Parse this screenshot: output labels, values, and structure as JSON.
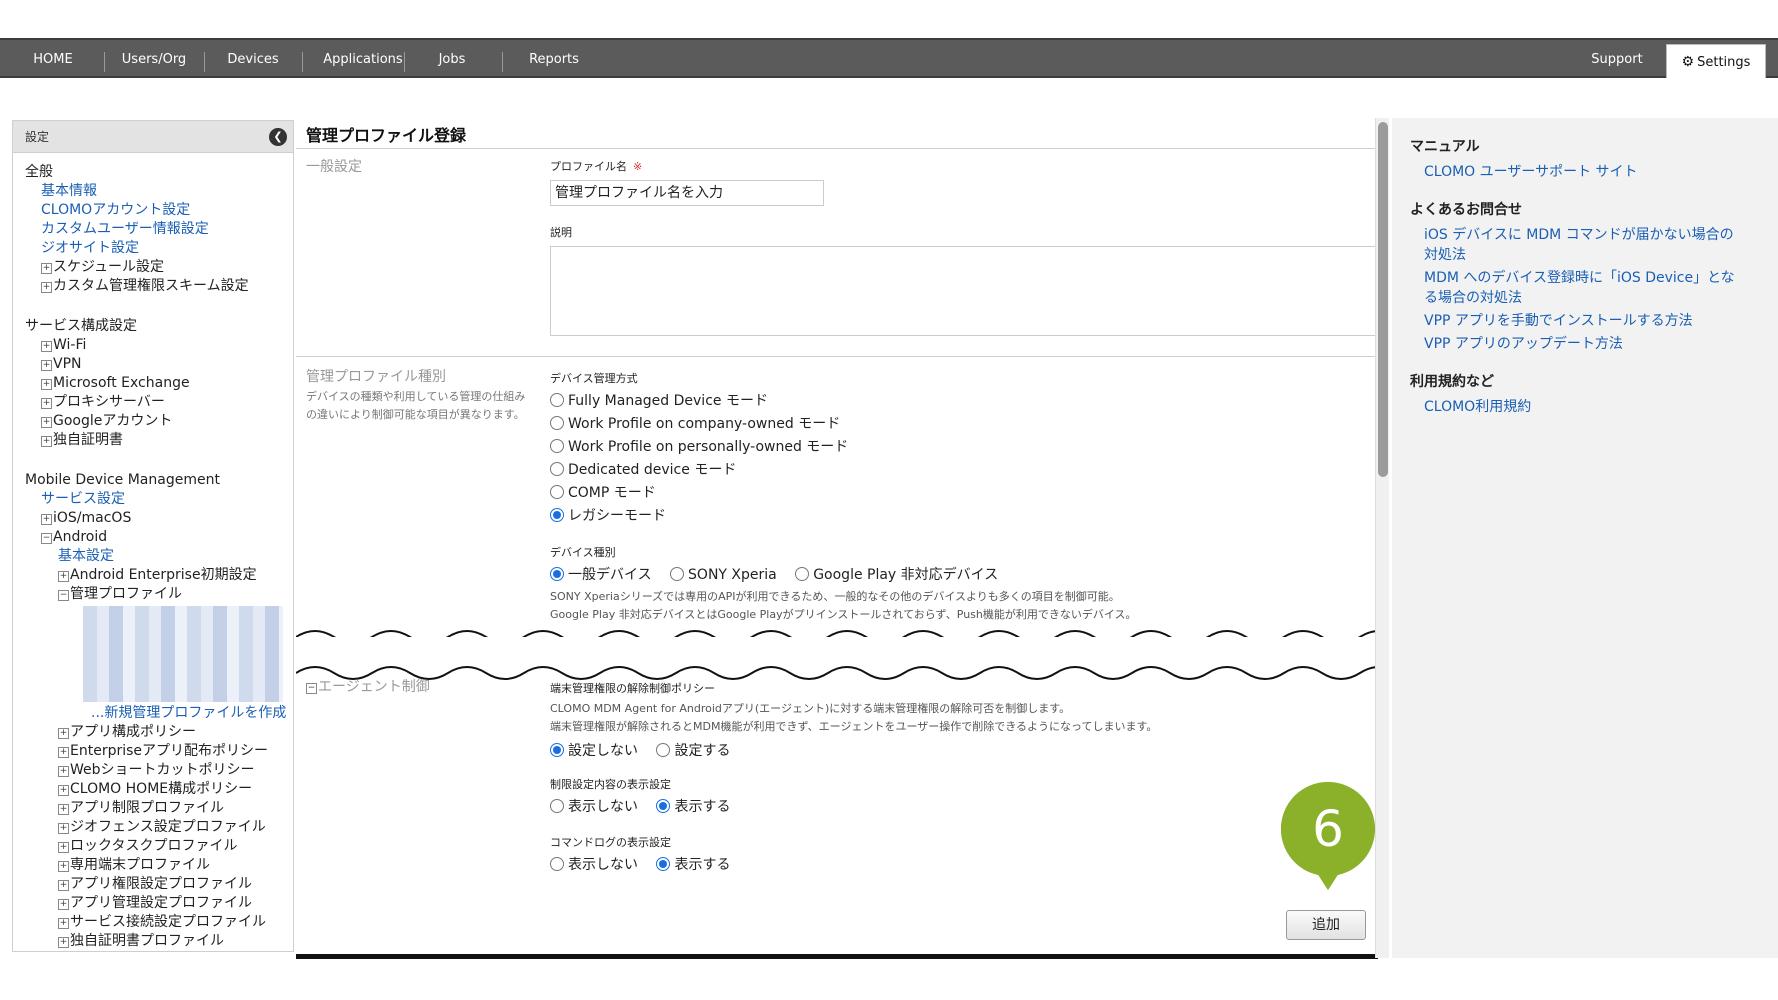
{
  "nav": {
    "items": [
      "HOME",
      "Users/Org",
      "Devices",
      "Applications",
      "Jobs",
      "Reports"
    ],
    "support": "Support",
    "settings": "Settings"
  },
  "sidebar": {
    "header": "設定",
    "general_title": "全般",
    "general_links": [
      "基本情報",
      "CLOMOアカウント設定",
      "カスタムユーザー情報設定",
      "ジオサイト設定"
    ],
    "general_expand": [
      "スケジュール設定",
      "カスタム管理権限スキーム設定"
    ],
    "service_title": "サービス構成設定",
    "service_items": [
      "Wi-Fi",
      "VPN",
      "Microsoft Exchange",
      "プロキシサーバー",
      "Googleアカウント",
      "独自証明書"
    ],
    "mdm_title": "Mobile Device Management",
    "mdm_service": "サービス設定",
    "ios": "iOS/macOS",
    "android": "Android",
    "android_basic": "基本設定",
    "android_enterprise": "Android Enterprise初期設定",
    "mgmt_profile": "管理プロファイル",
    "new_profile": "...新規管理プロファイルを作成",
    "policies": [
      "アプリ構成ポリシー",
      "Enterpriseアプリ配布ポリシー",
      "Webショートカットポリシー",
      "CLOMO HOME構成ポリシー",
      "アプリ制限プロファイル",
      "ジオフェンス設定プロファイル",
      "ロックタスクプロファイル",
      "専用端末プロファイル",
      "アプリ権限設定プロファイル",
      "アプリ管理設定プロファイル",
      "サービス接続設定プロファイル",
      "独自証明書プロファイル"
    ]
  },
  "main": {
    "title": "管理プロファイル登録",
    "general_section": "一般設定",
    "profile_name_label": "プロファイル名",
    "required_mark": "※",
    "profile_name_value": "管理プロファイル名を入力",
    "description_label": "説明",
    "type_section": "管理プロファイル種別",
    "type_desc": "デバイスの種類や利用している管理の仕組みの違いにより制御可能な項目が異なります。",
    "mgmt_method_label": "デバイス管理方式",
    "mgmt_methods": [
      "Fully Managed Device モード",
      "Work Profile on company-owned モード",
      "Work Profile on personally-owned モード",
      "Dedicated device モード",
      "COMP モード",
      "レガシーモード"
    ],
    "mgmt_method_selected": 5,
    "device_type_label": "デバイス種別",
    "device_types": [
      "一般デバイス",
      "SONY Xperia",
      "Google Play 非対応デバイス"
    ],
    "device_type_selected": 0,
    "device_note_1": "SONY Xperiaシリーズでは専用のAPIが利用できるため、一般的なその他のデバイスよりも多くの項目を制御可能。",
    "device_note_2": "Google Play 非対応デバイスとはGoogle Playがプリインストールされておらず、Push機能が利用できないデバイス。",
    "agent_section": "エージェント制御",
    "release_label": "端末管理権限の解除制御ポリシー",
    "release_note_1": "CLOMO MDM Agent for Androidアプリ(エージェント)に対する端末管理権限の解除可否を制御します。",
    "release_note_2": "端末管理権限が解除されるとMDM機能が利用できず、エージェントをユーザー操作で削除できるようになってしまいます。",
    "release_options": [
      "設定しない",
      "設定する"
    ],
    "release_selected": 0,
    "restriction_label": "制限設定内容の表示設定",
    "restriction_options": [
      "表示しない",
      "表示する"
    ],
    "restriction_selected": 1,
    "cmdlog_label": "コマンドログの表示設定",
    "cmdlog_options": [
      "表示しない",
      "表示する"
    ],
    "cmdlog_selected": 1,
    "add_button": "追加",
    "step_number": "6"
  },
  "help": {
    "manual_title": "マニュアル",
    "manual_links": [
      "CLOMO ユーザーサポート サイト"
    ],
    "faq_title": "よくあるお問合せ",
    "faq_links": [
      "iOS デバイスに MDM コマンドが届かない場合の対処法",
      "MDM へのデバイス登録時に「iOS Device」となる場合の対処法",
      "VPP アプリを手動でインストールする方法",
      "VPP アプリのアップデート方法"
    ],
    "terms_title": "利用規約など",
    "terms_links": [
      "CLOMO利用規約"
    ]
  },
  "colors": {
    "nav_bg": "#5b5b5b",
    "link": "#1a5fb4",
    "radio_on": "#1a6fe0",
    "step_marker": "#8bb12a"
  }
}
